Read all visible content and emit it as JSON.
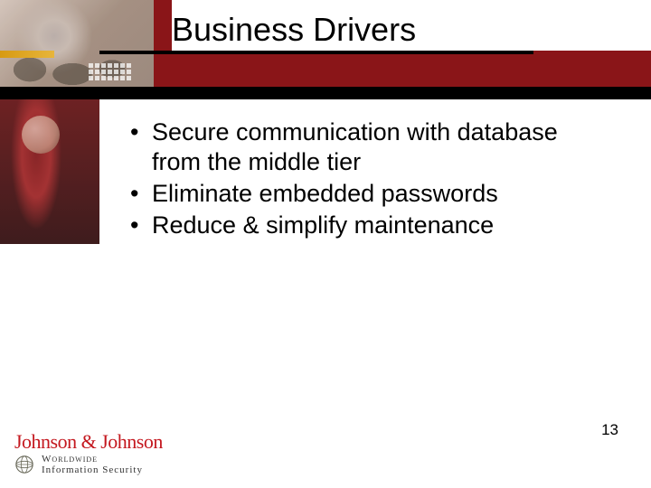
{
  "slide": {
    "title": "Business Drivers",
    "bullets": [
      "Secure communication with database from the middle tier",
      "Eliminate embedded passwords",
      "Reduce & simplify maintenance"
    ],
    "page_number": "13"
  },
  "footer": {
    "brand": "Johnson & Johnson",
    "sub_line1": "Worldwide",
    "sub_line2": "Information Security"
  },
  "colors": {
    "header_bg": "#8a1518",
    "brand_red": "#c4181f",
    "accent_gold": "#d79a12"
  }
}
